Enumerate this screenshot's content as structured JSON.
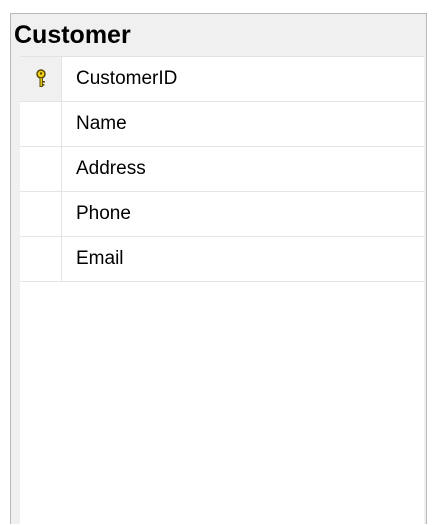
{
  "table": {
    "title": "Customer",
    "columns": [
      {
        "label": "CustomerID",
        "primary_key": true,
        "icon": "key-icon"
      },
      {
        "label": "Name",
        "primary_key": false
      },
      {
        "label": "Address",
        "primary_key": false
      },
      {
        "label": "Phone",
        "primary_key": false
      },
      {
        "label": "Email",
        "primary_key": false
      }
    ]
  },
  "colors": {
    "key_fill": "#f2d21b",
    "key_stroke": "#5a4a00",
    "border": "#b8b8b8",
    "header_bg": "#f0f0f0"
  }
}
